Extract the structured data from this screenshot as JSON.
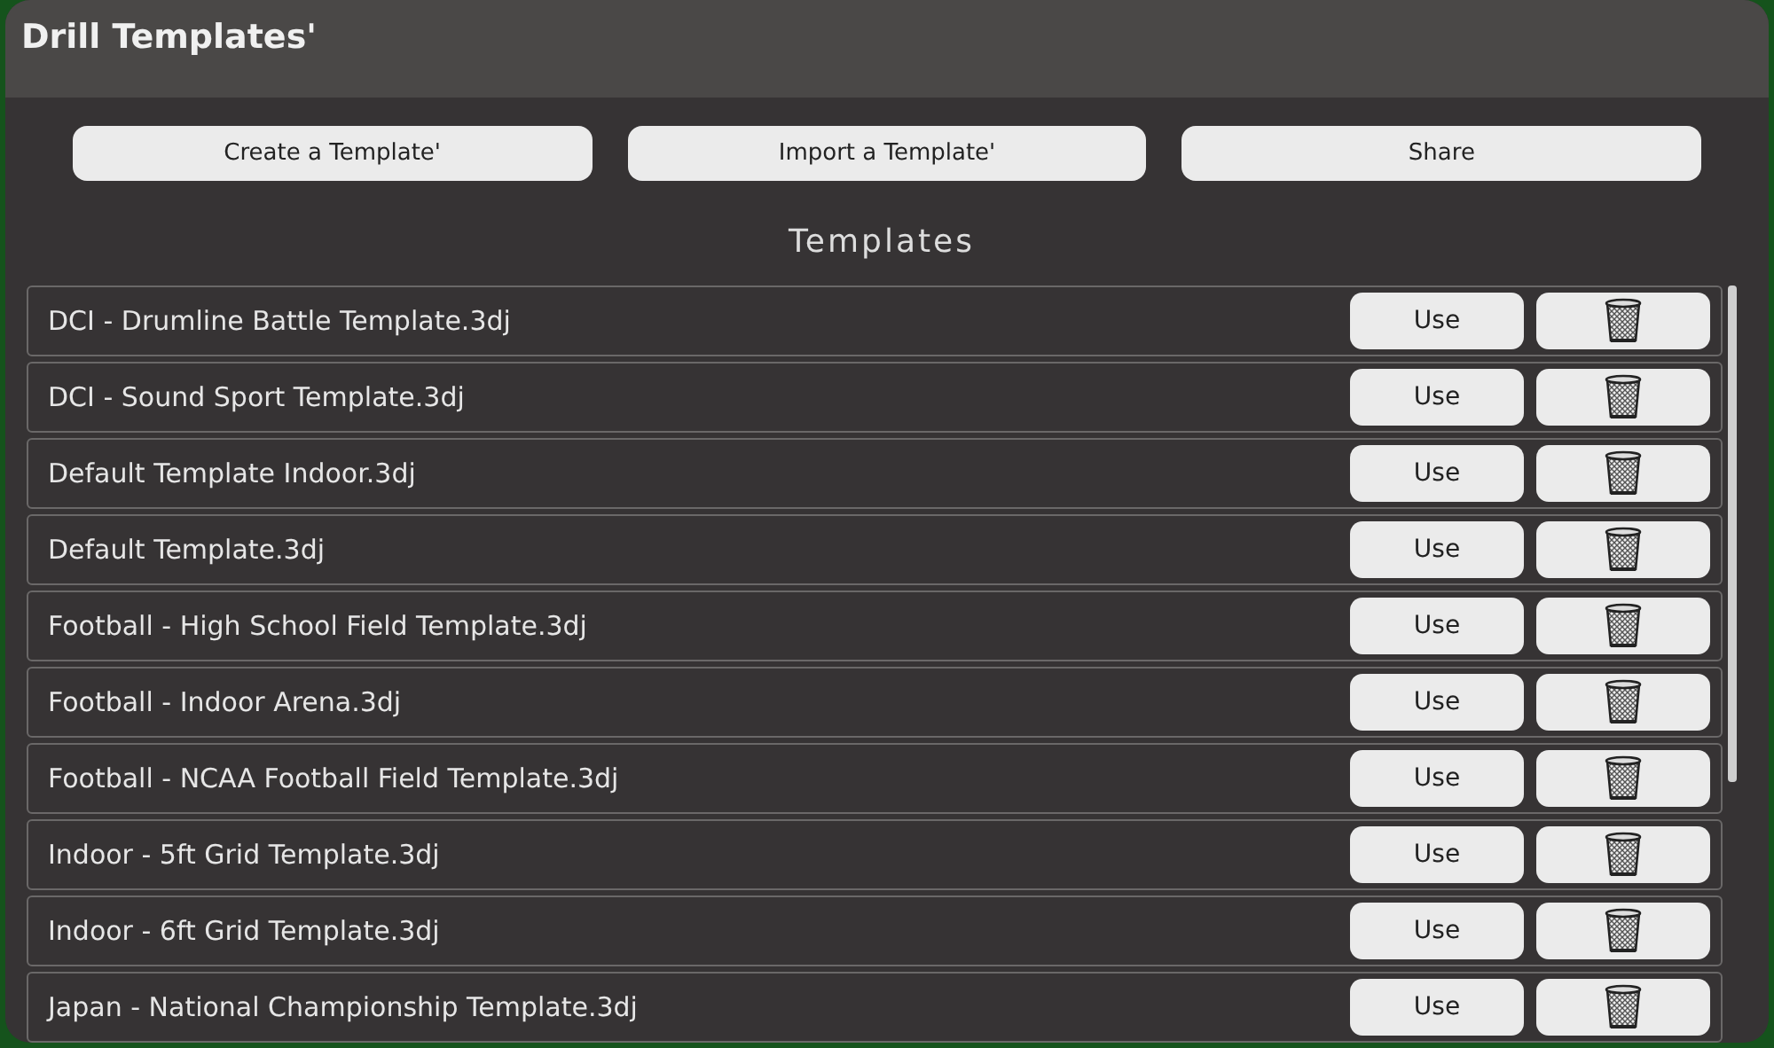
{
  "window": {
    "title": "Drill Templates'"
  },
  "actions": [
    "Create a Template'",
    "Import a Template'",
    "Share"
  ],
  "section_title": "Templates",
  "templates": [
    {
      "name": "DCI - Drumline Battle Template.3dj",
      "use_label": "Use"
    },
    {
      "name": "DCI - Sound Sport Template.3dj",
      "use_label": "Use"
    },
    {
      "name": "Default Template Indoor.3dj",
      "use_label": "Use"
    },
    {
      "name": "Default Template.3dj",
      "use_label": "Use"
    },
    {
      "name": "Football - High School Field Template.3dj",
      "use_label": "Use"
    },
    {
      "name": "Football - Indoor Arena.3dj",
      "use_label": "Use"
    },
    {
      "name": "Football - NCAA Football Field Template.3dj",
      "use_label": "Use"
    },
    {
      "name": "Indoor - 5ft Grid Template.3dj",
      "use_label": "Use"
    },
    {
      "name": "Indoor - 6ft Grid Template.3dj",
      "use_label": "Use"
    },
    {
      "name": "Japan - National Championship Template.3dj",
      "use_label": "Use"
    }
  ]
}
